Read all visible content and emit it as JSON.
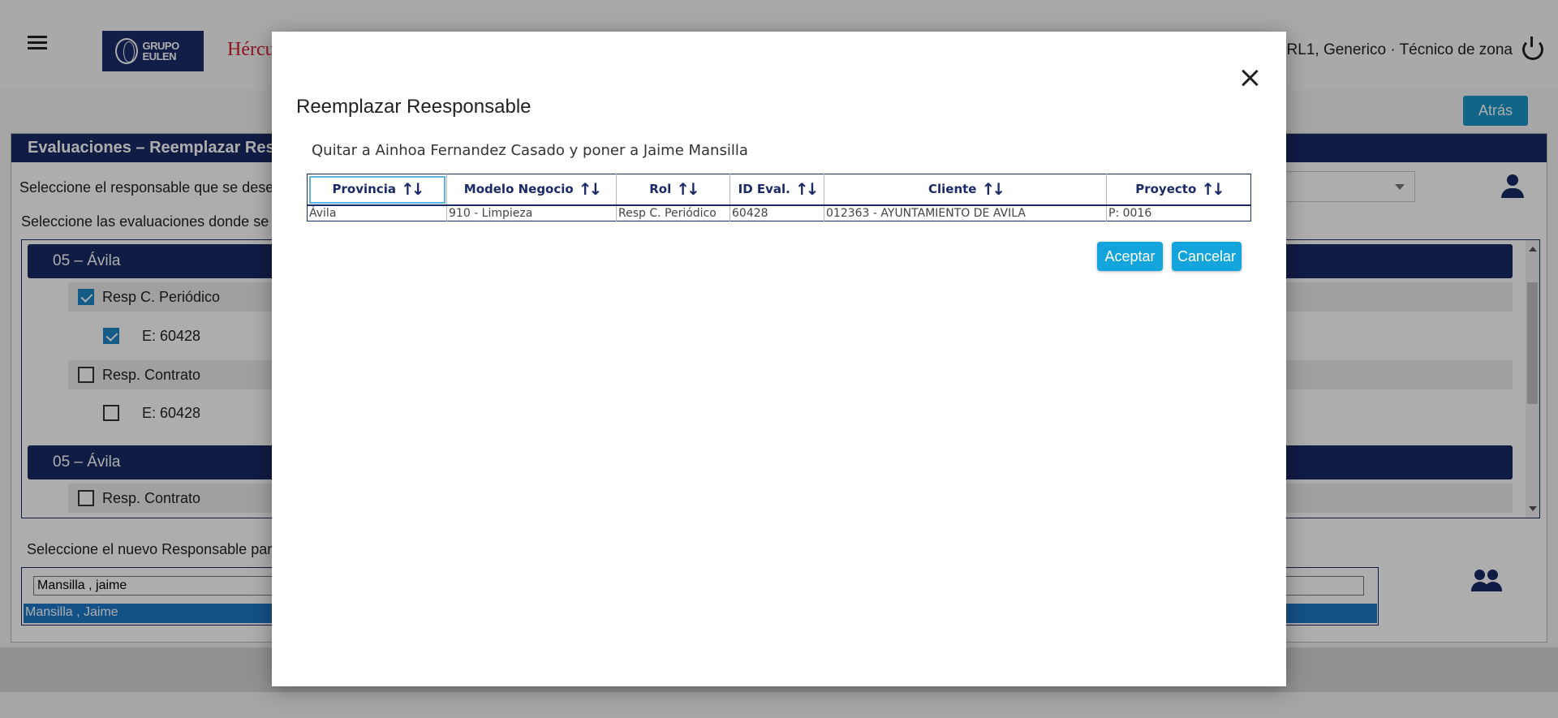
{
  "header": {
    "logo_text": "GRUPO EULEN",
    "app_title": "Hércules",
    "user_info": "RL1, Generico · Técnico de zona",
    "back_label": "Atrás"
  },
  "panel": {
    "title": "Evaluaciones – Reemplazar Responsable",
    "select_responsable_text": "Seleccione el responsable que se desea",
    "select_evaluaciones_text": "Seleccione las evaluaciones donde se re",
    "new_responsable_text": "Seleccione el nuevo Responsable para",
    "search_value": "Mansilla , jaime",
    "selected_option": "Mansilla , Jaime"
  },
  "tree": {
    "groups": [
      {
        "label": "05 – Ávila",
        "roles": [
          {
            "label": "Resp C. Periódico",
            "checked": true,
            "eval": "E: 60428",
            "eval_checked": true
          },
          {
            "label": "Resp. Contrato",
            "checked": false,
            "eval": "E: 60428",
            "eval_checked": false
          }
        ]
      },
      {
        "label": "05 – Ávila",
        "roles": [
          {
            "label": "Resp. Contrato",
            "checked": false
          }
        ]
      }
    ]
  },
  "modal": {
    "title": "Reemplazar Reesponsable",
    "description": "Quitar a Ainhoa Fernandez Casado y poner a Jaime Mansilla",
    "columns": [
      "Provincia",
      "Modelo Negocio",
      "Rol",
      "ID Eval.",
      "Cliente",
      "Proyecto"
    ],
    "rows": [
      [
        "Ávila",
        "910 - Limpieza",
        "Resp C. Periódico",
        "60428",
        "012363 - AYUNTAMIENTO DE AVILA",
        "P: 0016"
      ]
    ],
    "accept_label": "Aceptar",
    "cancel_label": "Cancelar",
    "sort_icon": "sort-icon"
  },
  "colors": {
    "navy": "#1a2a66",
    "accent_blue": "#14a4dc",
    "brand_red": "#d0202e"
  }
}
